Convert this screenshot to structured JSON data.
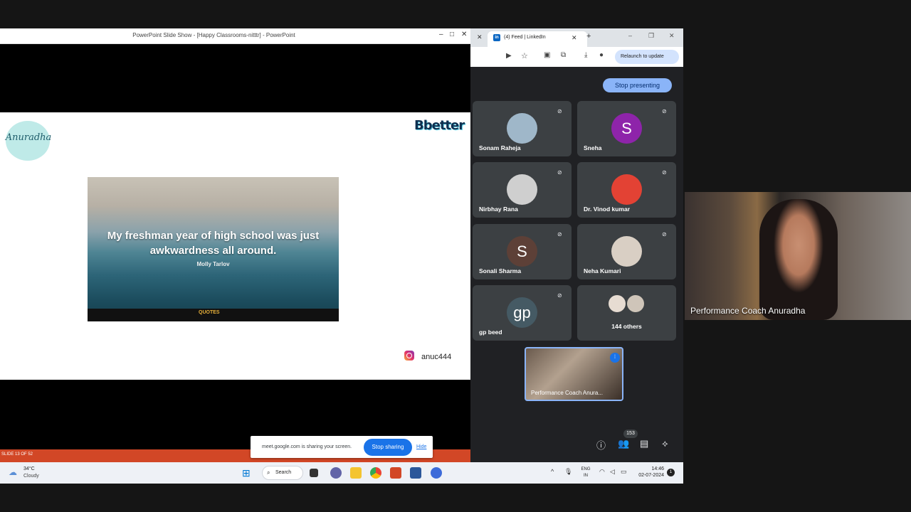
{
  "powerpoint": {
    "window_title": "PowerPoint Slide Show - [Happy Classrooms-nitttr] - PowerPoint",
    "slide_count": "SLIDE 13 OF 52",
    "logo_text": "Anuradha",
    "brand_text": "Bbetter",
    "quote": "My freshman year of high school was just awkwardness all around.",
    "quote_author": "Molly Tarlov",
    "quote_brand": "QUOTES",
    "instagram_handle": "anuc444"
  },
  "share_bar": {
    "message": "meet.google.com is sharing your screen.",
    "stop_label": "Stop sharing",
    "hide_label": "Hide"
  },
  "chrome": {
    "tab_title": "(4) Feed | LinkedIn",
    "relaunch_label": "Relaunch to update"
  },
  "meet": {
    "stop_presenting_label": "Stop presenting",
    "participants": [
      {
        "name": "Sonam Raheja",
        "initial": "",
        "color": "#9fb7c9"
      },
      {
        "name": "Sneha",
        "initial": "S",
        "color": "#8e24aa"
      },
      {
        "name": "Nirbhay Rana",
        "initial": "",
        "color": "#cfcfcf"
      },
      {
        "name": "Dr. Vinod kumar",
        "initial": "",
        "color": "#e34234"
      },
      {
        "name": "Sonali Sharma",
        "initial": "S",
        "color": "#5d4037"
      },
      {
        "name": "Neha Kumari",
        "initial": "",
        "color": "#d9cfc4"
      },
      {
        "name": "gp beed",
        "initial": "gp",
        "color": "#455a64"
      }
    ],
    "others_label": "144 others",
    "self_label": "Performance Coach Anura...",
    "participant_count": "153"
  },
  "camera": {
    "label": "Performance Coach Anuradha"
  },
  "taskbar": {
    "temperature": "34°C",
    "weather": "Cloudy",
    "search_label": "Search",
    "lang_line1": "ENG",
    "lang_line2": "IN",
    "time": "14:46",
    "date": "02-07-2024",
    "notifications": "1"
  }
}
